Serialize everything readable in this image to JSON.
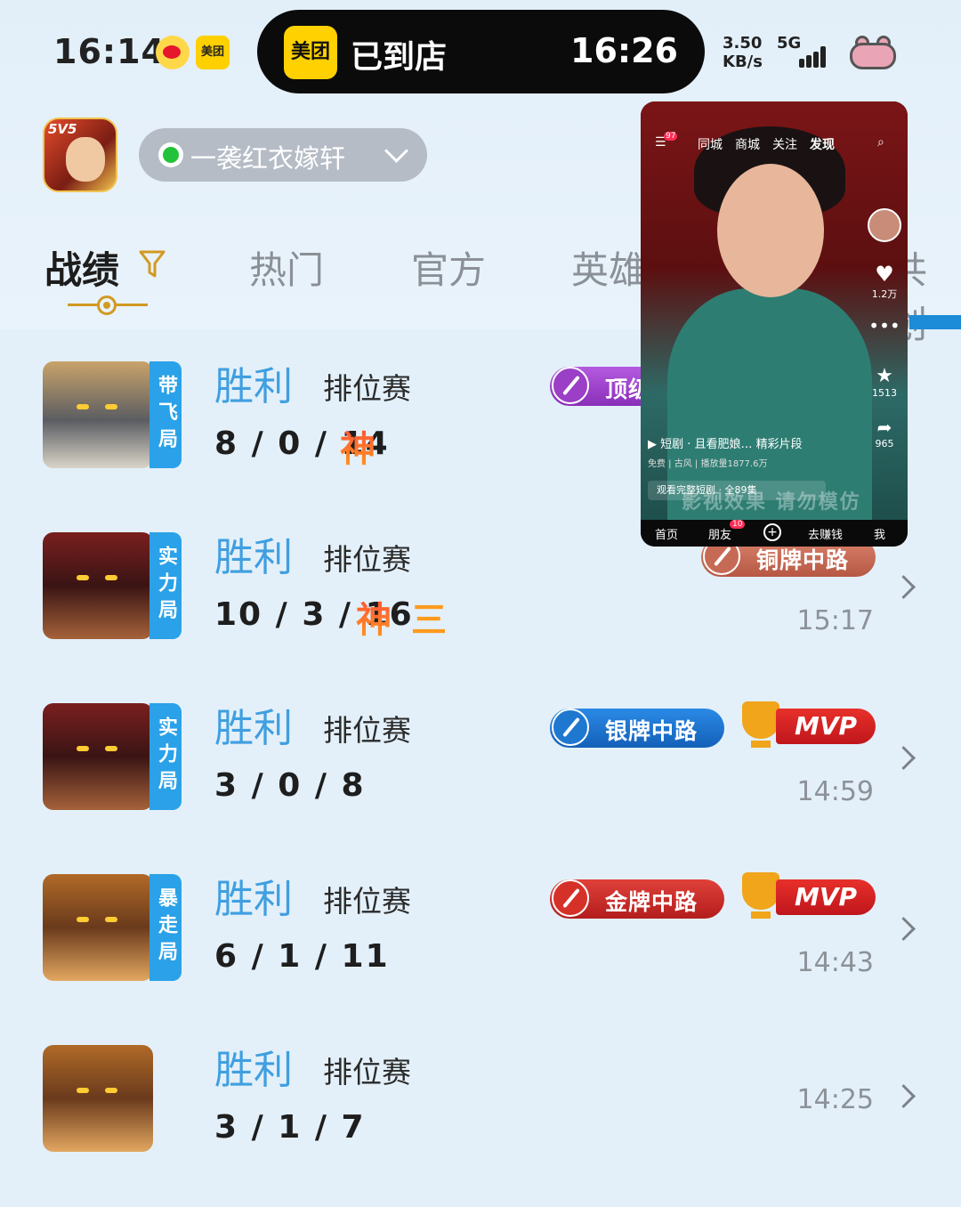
{
  "status_bar": {
    "time": "16:14",
    "notification_icons": [
      "weibo-icon",
      "meituan-icon"
    ],
    "meituan_label": "美团",
    "island": {
      "badge": "美团",
      "status": "已到店",
      "time": "16:26"
    },
    "net_speed_value": "3.50",
    "net_speed_unit": "KB/s",
    "network": "5G"
  },
  "account": {
    "app_badge": "5V5",
    "player_name": "一袭红衣嫁轩",
    "online_color": "#22c33a"
  },
  "tabs": [
    {
      "label": "战绩",
      "active": true
    },
    {
      "label": "热门"
    },
    {
      "label": "官方"
    },
    {
      "label": "英雄"
    },
    {
      "label": "共创"
    }
  ],
  "matches": [
    {
      "side_tag": "带飞局",
      "result": "胜利",
      "mode": "排位赛",
      "kda": "8 / 0 / 14",
      "honor": "神",
      "extra": "",
      "badge": "顶级…",
      "mvp": "",
      "time": ""
    },
    {
      "side_tag": "实力局",
      "result": "胜利",
      "mode": "排位赛",
      "kda": "10 / 3 / 16",
      "honor": "神",
      "extra": "三",
      "badge": "铜牌中路",
      "mvp": "",
      "time": "15:17"
    },
    {
      "side_tag": "实力局",
      "result": "胜利",
      "mode": "排位赛",
      "kda": "3 / 0 / 8",
      "honor": "",
      "extra": "",
      "badge": "银牌中路",
      "mvp": "MVP",
      "time": "14:59"
    },
    {
      "side_tag": "暴走局",
      "result": "胜利",
      "mode": "排位赛",
      "kda": "6 / 1 / 11",
      "honor": "",
      "extra": "",
      "badge": "金牌中路",
      "mvp": "MVP",
      "time": "14:43"
    },
    {
      "side_tag": "",
      "result": "胜利",
      "mode": "排位赛",
      "kda": "3 / 1 / 7",
      "honor": "",
      "extra": "",
      "badge": "",
      "mvp": "",
      "time": "14:25"
    }
  ],
  "pip_video": {
    "nav": [
      "同城",
      "商城",
      "关注",
      "发现"
    ],
    "like_count": "1.2万",
    "fav_count": "1513",
    "share_count": "965",
    "caption": "▶ 短剧 · 且看肥娘…  精彩片段",
    "sub": "免费 | 古风 | 播放量1877.6万",
    "banner": "观看完整短剧 · 全89集",
    "watermark": "影视效果 请勿模仿",
    "bottom_nav": [
      "首页",
      "朋友",
      "去赚钱",
      "我"
    ],
    "friend_badge": "10",
    "menu_badge": "97"
  },
  "colors": {
    "accent_blue": "#3f9fe0",
    "tab_indicator": "#d29a22",
    "mvp_red": "#d8231f",
    "badge_bronze": "#c76a55",
    "badge_silver": "#1f78cf",
    "badge_gold": "#d63129",
    "badge_top": "#9b3fc6"
  }
}
